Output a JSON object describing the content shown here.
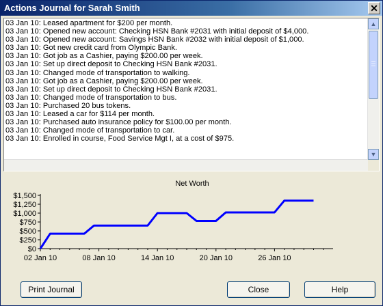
{
  "window": {
    "title": "Actions Journal for Sarah Smith",
    "close_glyph": "✕"
  },
  "journal": {
    "entries": [
      "03 Jan 10: Leased apartment for $200 per month.",
      "03 Jan 10: Opened new account: Checking HSN Bank #2031 with initial deposit of $4,000.",
      "03 Jan 10: Opened new account: Savings HSN Bank #2032 with initial deposit of $1,000.",
      "03 Jan 10: Got new credit card from Olympic Bank.",
      "03 Jan 10: Got job as a Cashier, paying $200.00 per week.",
      "03 Jan 10: Set up direct deposit to Checking HSN Bank #2031.",
      "03 Jan 10: Changed mode of transportation to walking.",
      "03 Jan 10: Got job as a Cashier, paying $200.00 per week.",
      "03 Jan 10: Set up direct deposit to Checking HSN Bank #2031.",
      "03 Jan 10: Changed mode of transportation to bus.",
      "03 Jan 10: Purchased 20 bus tokens.",
      "03 Jan 10: Leased a car for $114 per month.",
      "03 Jan 10: Purchased auto insurance policy for $100.00 per month.",
      "03 Jan 10: Changed mode of transportation to car.",
      "03 Jan 10: Enrolled in course, Food Service Mgt I, at a cost of $975."
    ]
  },
  "chart_data": {
    "type": "line",
    "title": "Net Worth",
    "xlabel": "",
    "ylabel": "",
    "x_ticks": [
      "02 Jan 10",
      "08 Jan 10",
      "14 Jan 10",
      "20 Jan 10",
      "26 Jan 10"
    ],
    "y_ticks": [
      "$0",
      "$250",
      "$500",
      "$750",
      "$1,000",
      "$1,250",
      "$1,500"
    ],
    "ylim": [
      0,
      1500
    ],
    "x_range_days": [
      0,
      30
    ],
    "grid": false,
    "series": [
      {
        "color": "#0000ff",
        "points": [
          {
            "x": 0,
            "y": 0
          },
          {
            "x": 1,
            "y": 420
          },
          {
            "x": 4.5,
            "y": 420
          },
          {
            "x": 5.5,
            "y": 650
          },
          {
            "x": 11,
            "y": 650
          },
          {
            "x": 12,
            "y": 1000
          },
          {
            "x": 15,
            "y": 1000
          },
          {
            "x": 16,
            "y": 780
          },
          {
            "x": 18,
            "y": 780
          },
          {
            "x": 19,
            "y": 1020
          },
          {
            "x": 24,
            "y": 1020
          },
          {
            "x": 25,
            "y": 1350
          },
          {
            "x": 28,
            "y": 1350
          }
        ]
      }
    ]
  },
  "buttons": {
    "print": "Print Journal",
    "close": "Close",
    "help": "Help"
  },
  "colors": {
    "accent": "#0a246a",
    "line": "#0000ff"
  }
}
